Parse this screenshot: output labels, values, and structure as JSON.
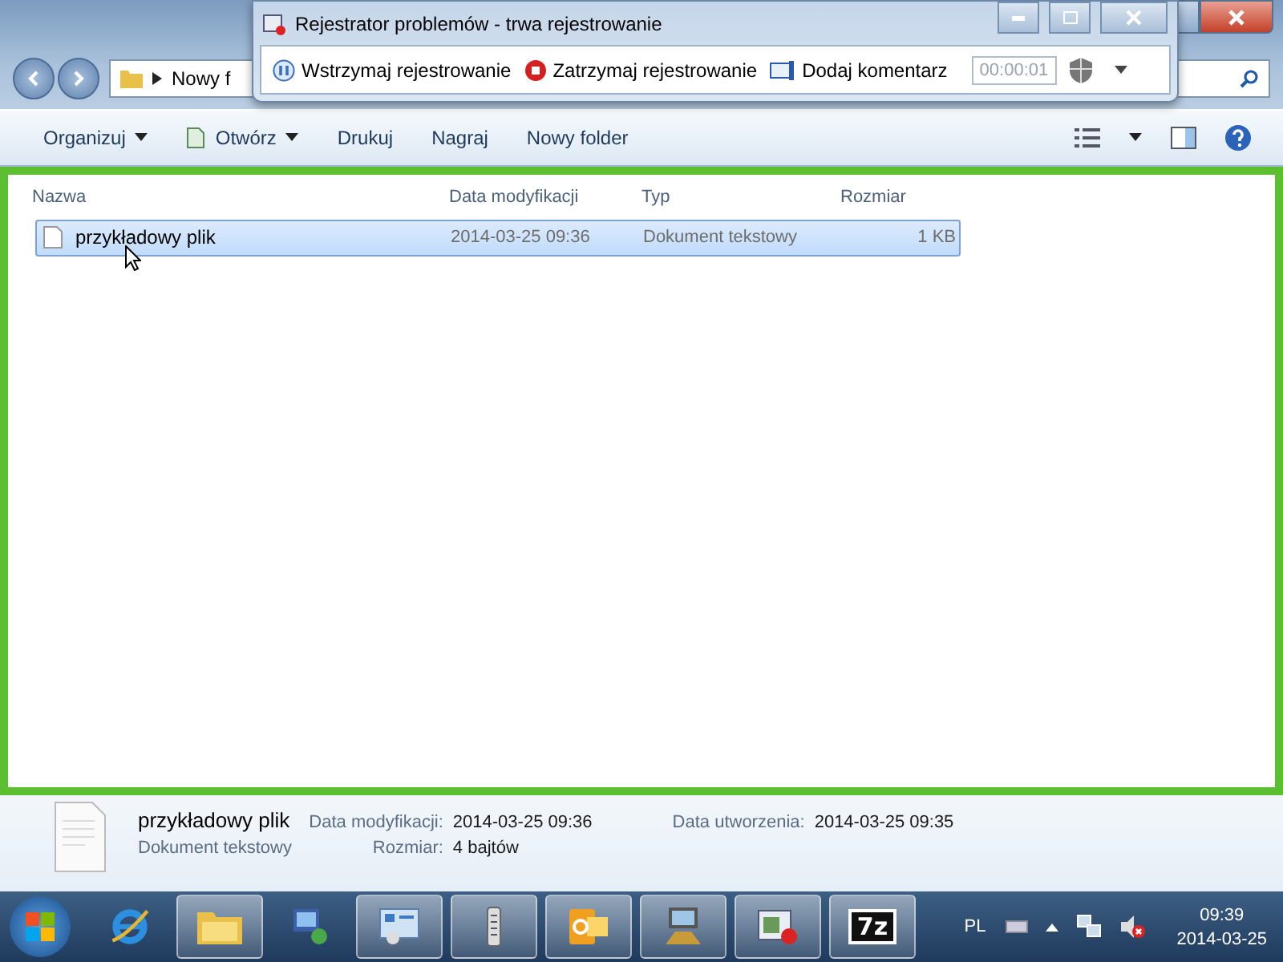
{
  "address": {
    "crumb": "Nowy f"
  },
  "recorder": {
    "title": "Rejestrator problemów - trwa rejestrowanie",
    "actions": [
      {
        "kind": "pause",
        "label": "Wstrzymaj rejestrowanie"
      },
      {
        "kind": "stop",
        "label": "Zatrzymaj rejestrowanie"
      },
      {
        "kind": "comment",
        "label": "Dodaj komentarz"
      }
    ],
    "timer": "00:00:01"
  },
  "toolbar": [
    {
      "label": "Organizuj",
      "kind": "menu"
    },
    {
      "label": "Otwórz",
      "kind": "open-menu"
    },
    {
      "label": "Drukuj",
      "kind": "plain"
    },
    {
      "label": "Nagraj",
      "kind": "plain"
    },
    {
      "label": "Nowy folder",
      "kind": "plain"
    }
  ],
  "columns": [
    "Nazwa",
    "Data modyfikacji",
    "Typ",
    "Rozmiar"
  ],
  "rows": [
    {
      "name": "przykładowy plik",
      "modified": "2014-03-25 09:36",
      "type": "Dokument tekstowy",
      "size": "1 KB",
      "selected": true
    }
  ],
  "details": {
    "name": "przykładowy plik",
    "type": "Dokument tekstowy",
    "modified_label": "Data modyfikacji:",
    "modified": "2014-03-25 09:36",
    "created_label": "Data utworzenia:",
    "created": "2014-03-25 09:35",
    "size_label": "Rozmiar:",
    "size": "4 bajtów"
  },
  "taskbar": {
    "apps": [
      {
        "kind": "ie"
      },
      {
        "kind": "folder"
      },
      {
        "kind": "network"
      },
      {
        "kind": "panel"
      },
      {
        "kind": "remote"
      },
      {
        "kind": "outlook"
      },
      {
        "kind": "computer"
      },
      {
        "kind": "recorder"
      },
      {
        "kind": "sevenzip",
        "label": "7z"
      }
    ],
    "language": "PL",
    "time": "09:39",
    "date": "2014-03-25"
  }
}
